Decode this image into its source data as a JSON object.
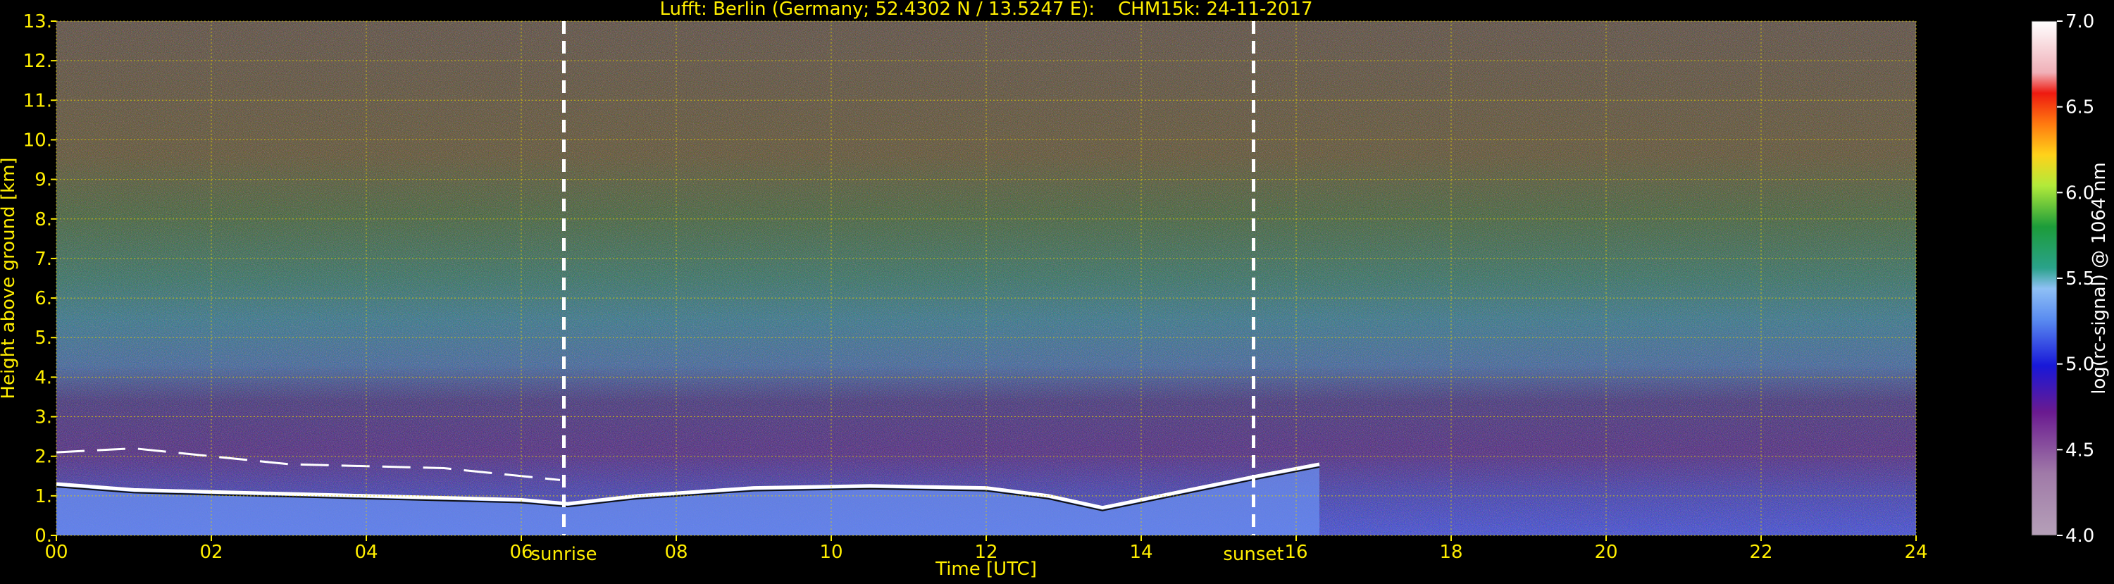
{
  "chart_data": {
    "type": "heatmap",
    "title": "Lufft: Berlin (Germany; 52.4302 N / 13.5247 E):    CHM15k: 24-11-2017",
    "xlabel": "Time [UTC]",
    "ylabel": "Height above ground [km]",
    "xlim": [
      0,
      24
    ],
    "ylim": [
      0,
      13
    ],
    "x_ticks": [
      "00",
      "02",
      "04",
      "06",
      "08",
      "10",
      "12",
      "14",
      "16",
      "18",
      "20",
      "22",
      "24"
    ],
    "y_ticks": [
      "0.",
      "1.",
      "2.",
      "3.",
      "4.",
      "5.",
      "6.",
      "7.",
      "8.",
      "9.",
      "10.",
      "11.",
      "12.",
      "13."
    ],
    "grid": true,
    "events": [
      {
        "label": "sunrise",
        "time": 6.55
      },
      {
        "label": "sunset",
        "time": 15.45
      }
    ],
    "colorbar": {
      "label": "log(rc-signal) @ 1064 nm",
      "range": [
        4.0,
        7.0
      ],
      "ticks": [
        "4.0",
        "4.5",
        "5.0",
        "5.5",
        "6.0",
        "6.5",
        "7.0"
      ]
    },
    "features": {
      "boundary_layer_top_km": [
        {
          "t": 0.0,
          "h": 1.3
        },
        {
          "t": 1.0,
          "h": 1.15
        },
        {
          "t": 2.0,
          "h": 1.1
        },
        {
          "t": 3.0,
          "h": 1.05
        },
        {
          "t": 4.0,
          "h": 1.0
        },
        {
          "t": 5.0,
          "h": 0.95
        },
        {
          "t": 6.0,
          "h": 0.9
        },
        {
          "t": 6.6,
          "h": 0.8
        },
        {
          "t": 7.5,
          "h": 1.0
        },
        {
          "t": 9.0,
          "h": 1.2
        },
        {
          "t": 10.5,
          "h": 1.25
        },
        {
          "t": 12.0,
          "h": 1.2
        },
        {
          "t": 12.8,
          "h": 1.0
        },
        {
          "t": 13.5,
          "h": 0.7
        },
        {
          "t": 14.5,
          "h": 1.1
        },
        {
          "t": 15.5,
          "h": 1.5
        },
        {
          "t": 16.3,
          "h": 1.8
        }
      ],
      "aerosol_layer_top_km": [
        {
          "t": 0.0,
          "h": 2.1
        },
        {
          "t": 1.0,
          "h": 2.2
        },
        {
          "t": 3.0,
          "h": 1.8
        },
        {
          "t": 5.0,
          "h": 1.7
        },
        {
          "t": 6.5,
          "h": 1.4
        }
      ]
    }
  }
}
